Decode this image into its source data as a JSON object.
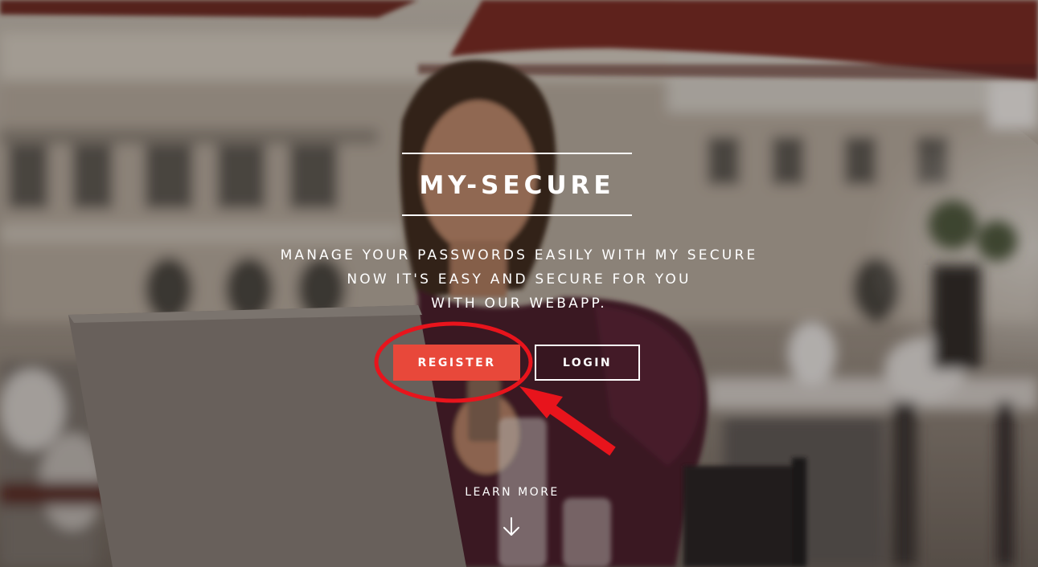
{
  "hero": {
    "title": "MY-SECURE",
    "tagline": [
      "MANAGE YOUR PASSWORDS EASILY WITH MY SECURE",
      "NOW IT'S EASY AND SECURE FOR YOU",
      "WITH OUR WEBAPP."
    ],
    "register_label": "REGISTER",
    "login_label": "LOGIN",
    "learn_more_label": "LEARN MORE",
    "learn_more_icon": "arrow-down-icon"
  },
  "colors": {
    "accent": "#e8483a",
    "annotation": "#e8141c",
    "text": "#ffffff"
  }
}
